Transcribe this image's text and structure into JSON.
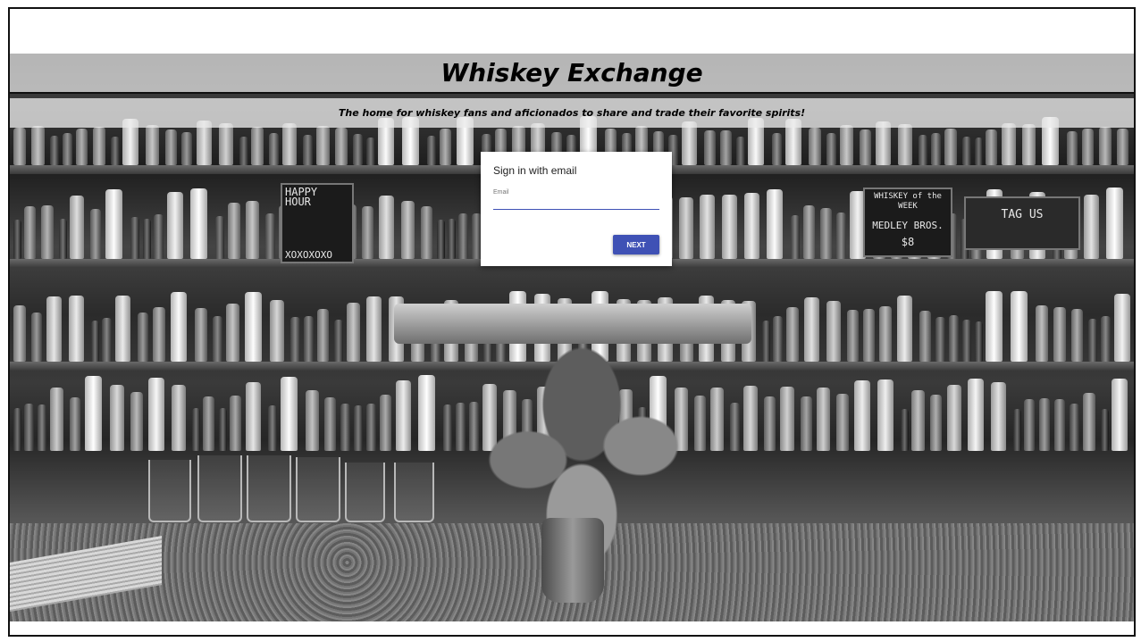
{
  "header": {
    "title": "Whiskey Exchange",
    "tagline": "The home for whiskey fans and aficionados to share and trade their favorite spirits!"
  },
  "signin": {
    "heading": "Sign in with email",
    "email_label": "Email",
    "email_value": "",
    "next_label": "NEXT"
  },
  "colors": {
    "primary": "#3f51b5",
    "band": "#ebebeb",
    "border": "#111111"
  },
  "background": {
    "chalkboard_left": "HAPPY HOUR",
    "chalkboard_left_sign": "XOXOXOXO",
    "chalkboard_right_line1": "WHISKEY of the WEEK",
    "chalkboard_right_line2": "MEDLEY BROS.",
    "chalkboard_right_price": "$8",
    "sign_far_right": "TAG US"
  }
}
